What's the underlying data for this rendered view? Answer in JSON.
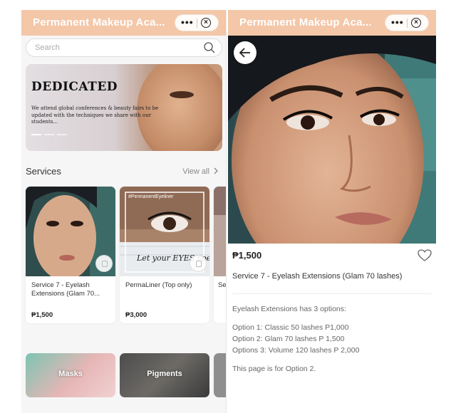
{
  "app": {
    "title": "Permanent Makeup Aca...",
    "capsule_more": "•••",
    "capsule_close": "×"
  },
  "list_page": {
    "search": {
      "placeholder": "Search"
    },
    "banner": {
      "heading": "DEDICATED",
      "text": "We attend global conferences & beauty fairs to be updated with the techniques we share with our students...",
      "slide_count": 3,
      "active_slide": 1
    },
    "services": {
      "title": "Services",
      "view_all": "View all",
      "items": [
        {
          "name": "Service 7 - Eyelash Extensions (Glam 70...",
          "price": "₱1,500"
        },
        {
          "name": "PermaLiner (Top only)",
          "price": "₱3,000",
          "image_text": "#PermanentEyeliner",
          "image_caption": "Let your EYES speak"
        },
        {
          "name": "Se M",
          "price": ""
        }
      ]
    },
    "categories": [
      {
        "label": "Masks"
      },
      {
        "label": "Pigments"
      }
    ]
  },
  "detail_page": {
    "price": "₱1,500",
    "name": "Service 7 - Eyelash Extensions (Glam 70 lashes)",
    "description": {
      "intro": "Eyelash Extensions has 3 options:",
      "options": [
        "Option 1: Classic 50 lashes P1,000",
        "Option 2: Glam 70 lashes P 1,500",
        "Options 3: Volume 120 lashes P 2,000"
      ],
      "note": "This page is for Option 2."
    }
  },
  "colors": {
    "accent": "#f3c7a8",
    "text": "#333333",
    "muted": "#888888"
  }
}
